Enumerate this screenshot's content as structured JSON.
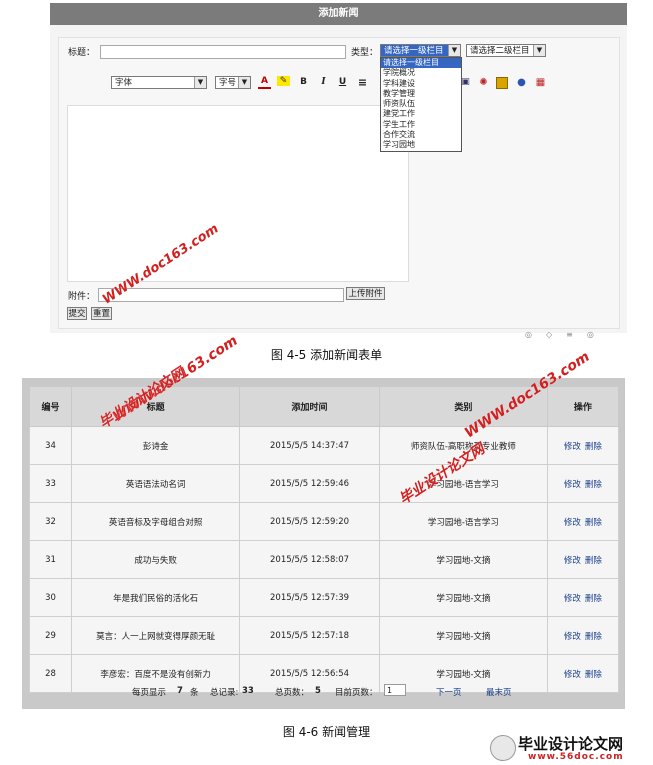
{
  "form": {
    "header": "添加新闻",
    "title_label": "标题：",
    "type_label": "类型：",
    "category1_selected": "请选择一级栏目",
    "category2_selected": "请选择二级栏目",
    "category1_options": [
      "请选择一级栏目",
      "学院概况",
      "学科建设",
      "教学管理",
      "师资队伍",
      "建党工作",
      "学生工作",
      "合作交流",
      "学习园地"
    ],
    "font_select": "字体",
    "size_select": "字号",
    "toolbar": {
      "bold": "B",
      "italic": "I",
      "underline": "U"
    },
    "attachment_label": "附件：",
    "upload_button": "上传附件",
    "submit_button": "提交",
    "reset_button": "重置"
  },
  "captions": {
    "fig1": "图 4-5 添加新闻表单",
    "fig2": "图 4-6 新闻管理"
  },
  "table": {
    "headers": [
      "编号",
      "标题",
      "添加时间",
      "类别",
      "操作"
    ],
    "edit_label": "修改",
    "delete_label": "删除",
    "rows": [
      {
        "id": "34",
        "title": "彭诗金",
        "time": "2015/5/5 14:37:47",
        "category": "师资队伍-高职称及专业教师"
      },
      {
        "id": "33",
        "title": "英语语法动名词",
        "time": "2015/5/5 12:59:46",
        "category": "学习园地-语言学习"
      },
      {
        "id": "32",
        "title": "英语音标及字母组合对照",
        "time": "2015/5/5 12:59:20",
        "category": "学习园地-语言学习"
      },
      {
        "id": "31",
        "title": "成功与失败",
        "time": "2015/5/5 12:58:07",
        "category": "学习园地-文摘"
      },
      {
        "id": "30",
        "title": "年是我们民俗的活化石",
        "time": "2015/5/5 12:57:39",
        "category": "学习园地-文摘"
      },
      {
        "id": "29",
        "title": "莫言：人一上网就变得厚颜无耻",
        "time": "2015/5/5 12:57:18",
        "category": "学习园地-文摘"
      },
      {
        "id": "28",
        "title": "李彦宏：百度不是没有创新力",
        "time": "2015/5/5 12:56:54",
        "category": "学习园地-文摘"
      }
    ]
  },
  "pager": {
    "per_page_label": "每页显示",
    "per_page": "7",
    "per_page_unit": "条",
    "total_label": "总记录:",
    "total": "33",
    "pages_label": "总页数：",
    "pages": "5",
    "current_label": "目前页数：",
    "current": "1",
    "next": "下一页",
    "last": "最末页"
  },
  "watermarks": {
    "site": "WWW.doc163.com",
    "cn": "毕业设计论文网"
  },
  "logo": {
    "name": "毕业设计论文网",
    "url": "www.56doc.com"
  }
}
